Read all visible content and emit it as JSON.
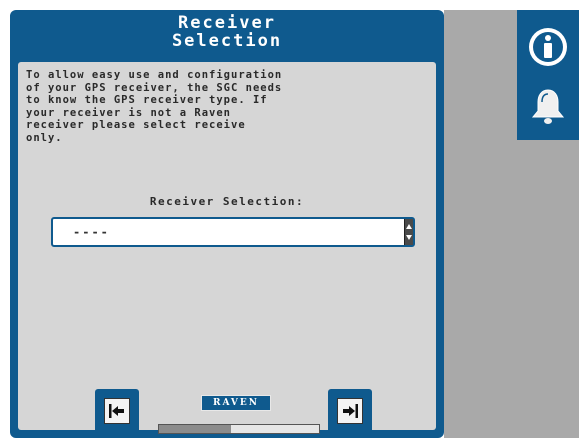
{
  "dialog": {
    "title_line1": "Receiver",
    "title_line2": "Selection",
    "description": "To allow easy use and configuration\nof your GPS receiver, the SGC needs\nto know the GPS receiver type. If\nyour receiver is not a Raven\nreceiver please select receive\nonly."
  },
  "receiver_field": {
    "label": "Receiver Selection:",
    "value": "----"
  },
  "footer": {
    "logo_text": "RAVEN",
    "progress_fraction": 0.45
  },
  "toolbar": {
    "icons": [
      "info-icon",
      "alarm-bell-icon"
    ]
  },
  "colors": {
    "panel_blue": "#0f5a8e",
    "content_grey": "#d6d6d6",
    "side_grey": "#a9a9a9"
  }
}
